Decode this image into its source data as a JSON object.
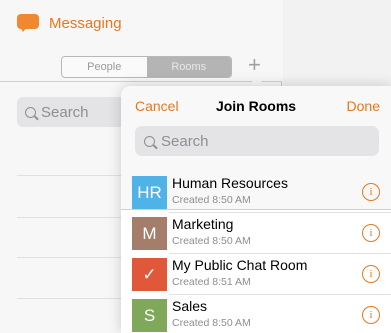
{
  "app": {
    "brand_label": "Messaging",
    "segments": [
      {
        "label": "People",
        "selected": false
      },
      {
        "label": "Rooms",
        "selected": true
      }
    ],
    "add_icon": "plus-icon",
    "search_placeholder": "Search"
  },
  "popover": {
    "cancel_label": "Cancel",
    "title": "Join Rooms",
    "done_label": "Done",
    "search_placeholder": "Search",
    "rooms": [
      {
        "avatar_text": "HR",
        "avatar_color": "#4fb3e8",
        "name": "Human Resources",
        "subtitle": "Created 8:50 AM"
      },
      {
        "avatar_text": "M",
        "avatar_color": "#a47e6a",
        "name": "Marketing",
        "subtitle": "Created 8:50 AM"
      },
      {
        "avatar_text": "✓",
        "avatar_color": "#e0583a",
        "name": "My Public Chat Room",
        "subtitle": "Created 8:51 AM"
      },
      {
        "avatar_text": "S",
        "avatar_color": "#7fa85a",
        "name": "Sales",
        "subtitle": "Created 8:50 AM"
      }
    ],
    "info_icon": "info-icon"
  },
  "colors": {
    "accent": "#e8771e"
  }
}
